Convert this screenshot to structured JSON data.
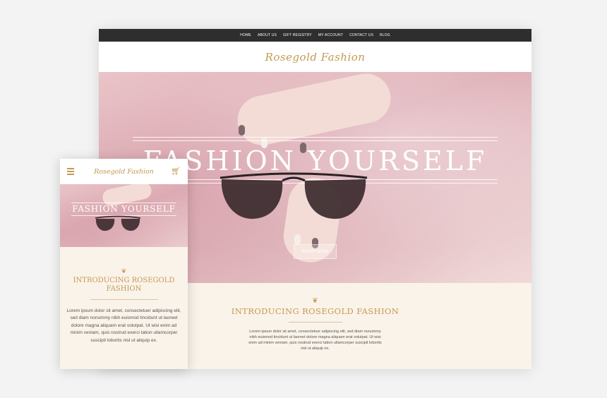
{
  "desktop": {
    "nav": [
      {
        "label": "HOME"
      },
      {
        "label": "ABOUT US"
      },
      {
        "label": "GIFT REGISTRY"
      },
      {
        "label": "MY ACCOUNT"
      },
      {
        "label": "CONTACT US"
      },
      {
        "label": "BLOG"
      }
    ],
    "logo": "Rosegold Fashion",
    "hero": {
      "title": "FASHION YOURSELF",
      "button": "SHOP NOW"
    },
    "intro_title": "INTRODUCING ROSEGOLD FASHION",
    "intro_body": "Lorem ipsum dolor sit amet, consectetuer adipiscing elit, sed diam nonummy nibh euismod tincidunt ut laoreet dolore magna aliquam erat volutpat. Ut wisi enim ad minim veniam, quis nostrud exerci tation ullamcorper suscipit lobortis nisl ut aliquip ex."
  },
  "mobile": {
    "logo": "Rosegold Fashion",
    "hero_title": "FASHION YOURSELF",
    "intro_title": "INTRODUCING ROSEGOLD FASHION",
    "intro_body": "Lorem ipsum dolor sit amet, consectetuer adipiscing elit, sed diam nonummy nibh euismod tincidunt ut laoreet dolore magna aliquam erat volutpat. Ut wisi enim ad minim veniam, quis nostrud exerci tation ullamcorper suscipit lobortis nisl ut aliquip ex."
  },
  "icons": {
    "menu": "hamburger-icon",
    "cart": "cart-icon",
    "ornament": "flourish-icon"
  },
  "colors": {
    "gold": "#c49a52",
    "nav_dark": "#2e2e2e",
    "cream": "#faf3ea",
    "hero_pink": "#dcaab2"
  }
}
